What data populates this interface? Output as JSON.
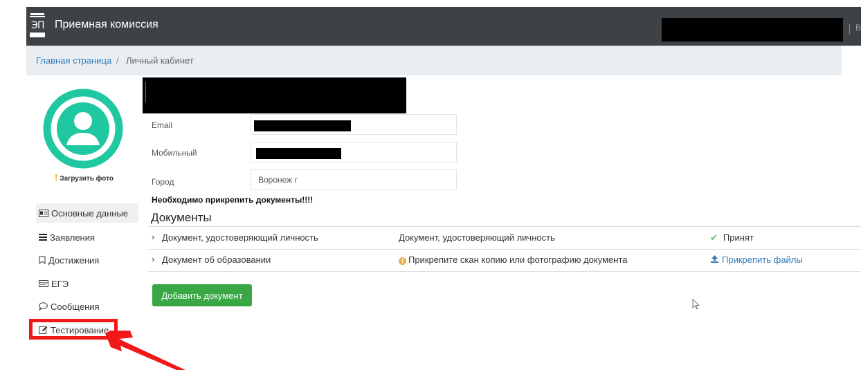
{
  "header": {
    "title": "Приемная комиссия",
    "logout_label": "Вы"
  },
  "breadcrumb": {
    "home": "Главная страница",
    "separator": "/",
    "current": "Личный кабинет"
  },
  "profile": {
    "upload_photo": "Загрузить фото"
  },
  "sidebar": {
    "items": [
      {
        "label": "Основные данные",
        "icon": "id-card-icon"
      },
      {
        "label": "Заявления",
        "icon": "list-icon"
      },
      {
        "label": "Достижения",
        "icon": "bookmark-icon"
      },
      {
        "label": "ЕГЭ",
        "icon": "card-icon"
      },
      {
        "label": "Сообщения",
        "icon": "chat-icon"
      },
      {
        "label": "Тестирование",
        "icon": "edit-icon"
      }
    ]
  },
  "form": {
    "email_label": "Email",
    "phone_label": "Мобильный",
    "city_label": "Город",
    "city_value": "Воронеж г"
  },
  "notice": "Необходимо прикрепить документы!!!!",
  "documents": {
    "heading": "Документы",
    "rows": [
      {
        "name": "Документ, удостоверяющий личность",
        "description": "Документ, удостоверяющий личность",
        "status": "Принят"
      },
      {
        "name": "Документ об образовании",
        "description": "Прикрепите скан копию или фотографию документа",
        "action": "Прикрепить файлы"
      }
    ],
    "add_button": "Добавить документ"
  },
  "colors": {
    "header_bg": "#3d4247",
    "breadcrumb_bg": "#e9eef2",
    "link": "#337ab7",
    "avatar": "#1fc8a0",
    "success": "#3aa745",
    "warning": "#f0ad4e",
    "highlight": "#f01818"
  }
}
